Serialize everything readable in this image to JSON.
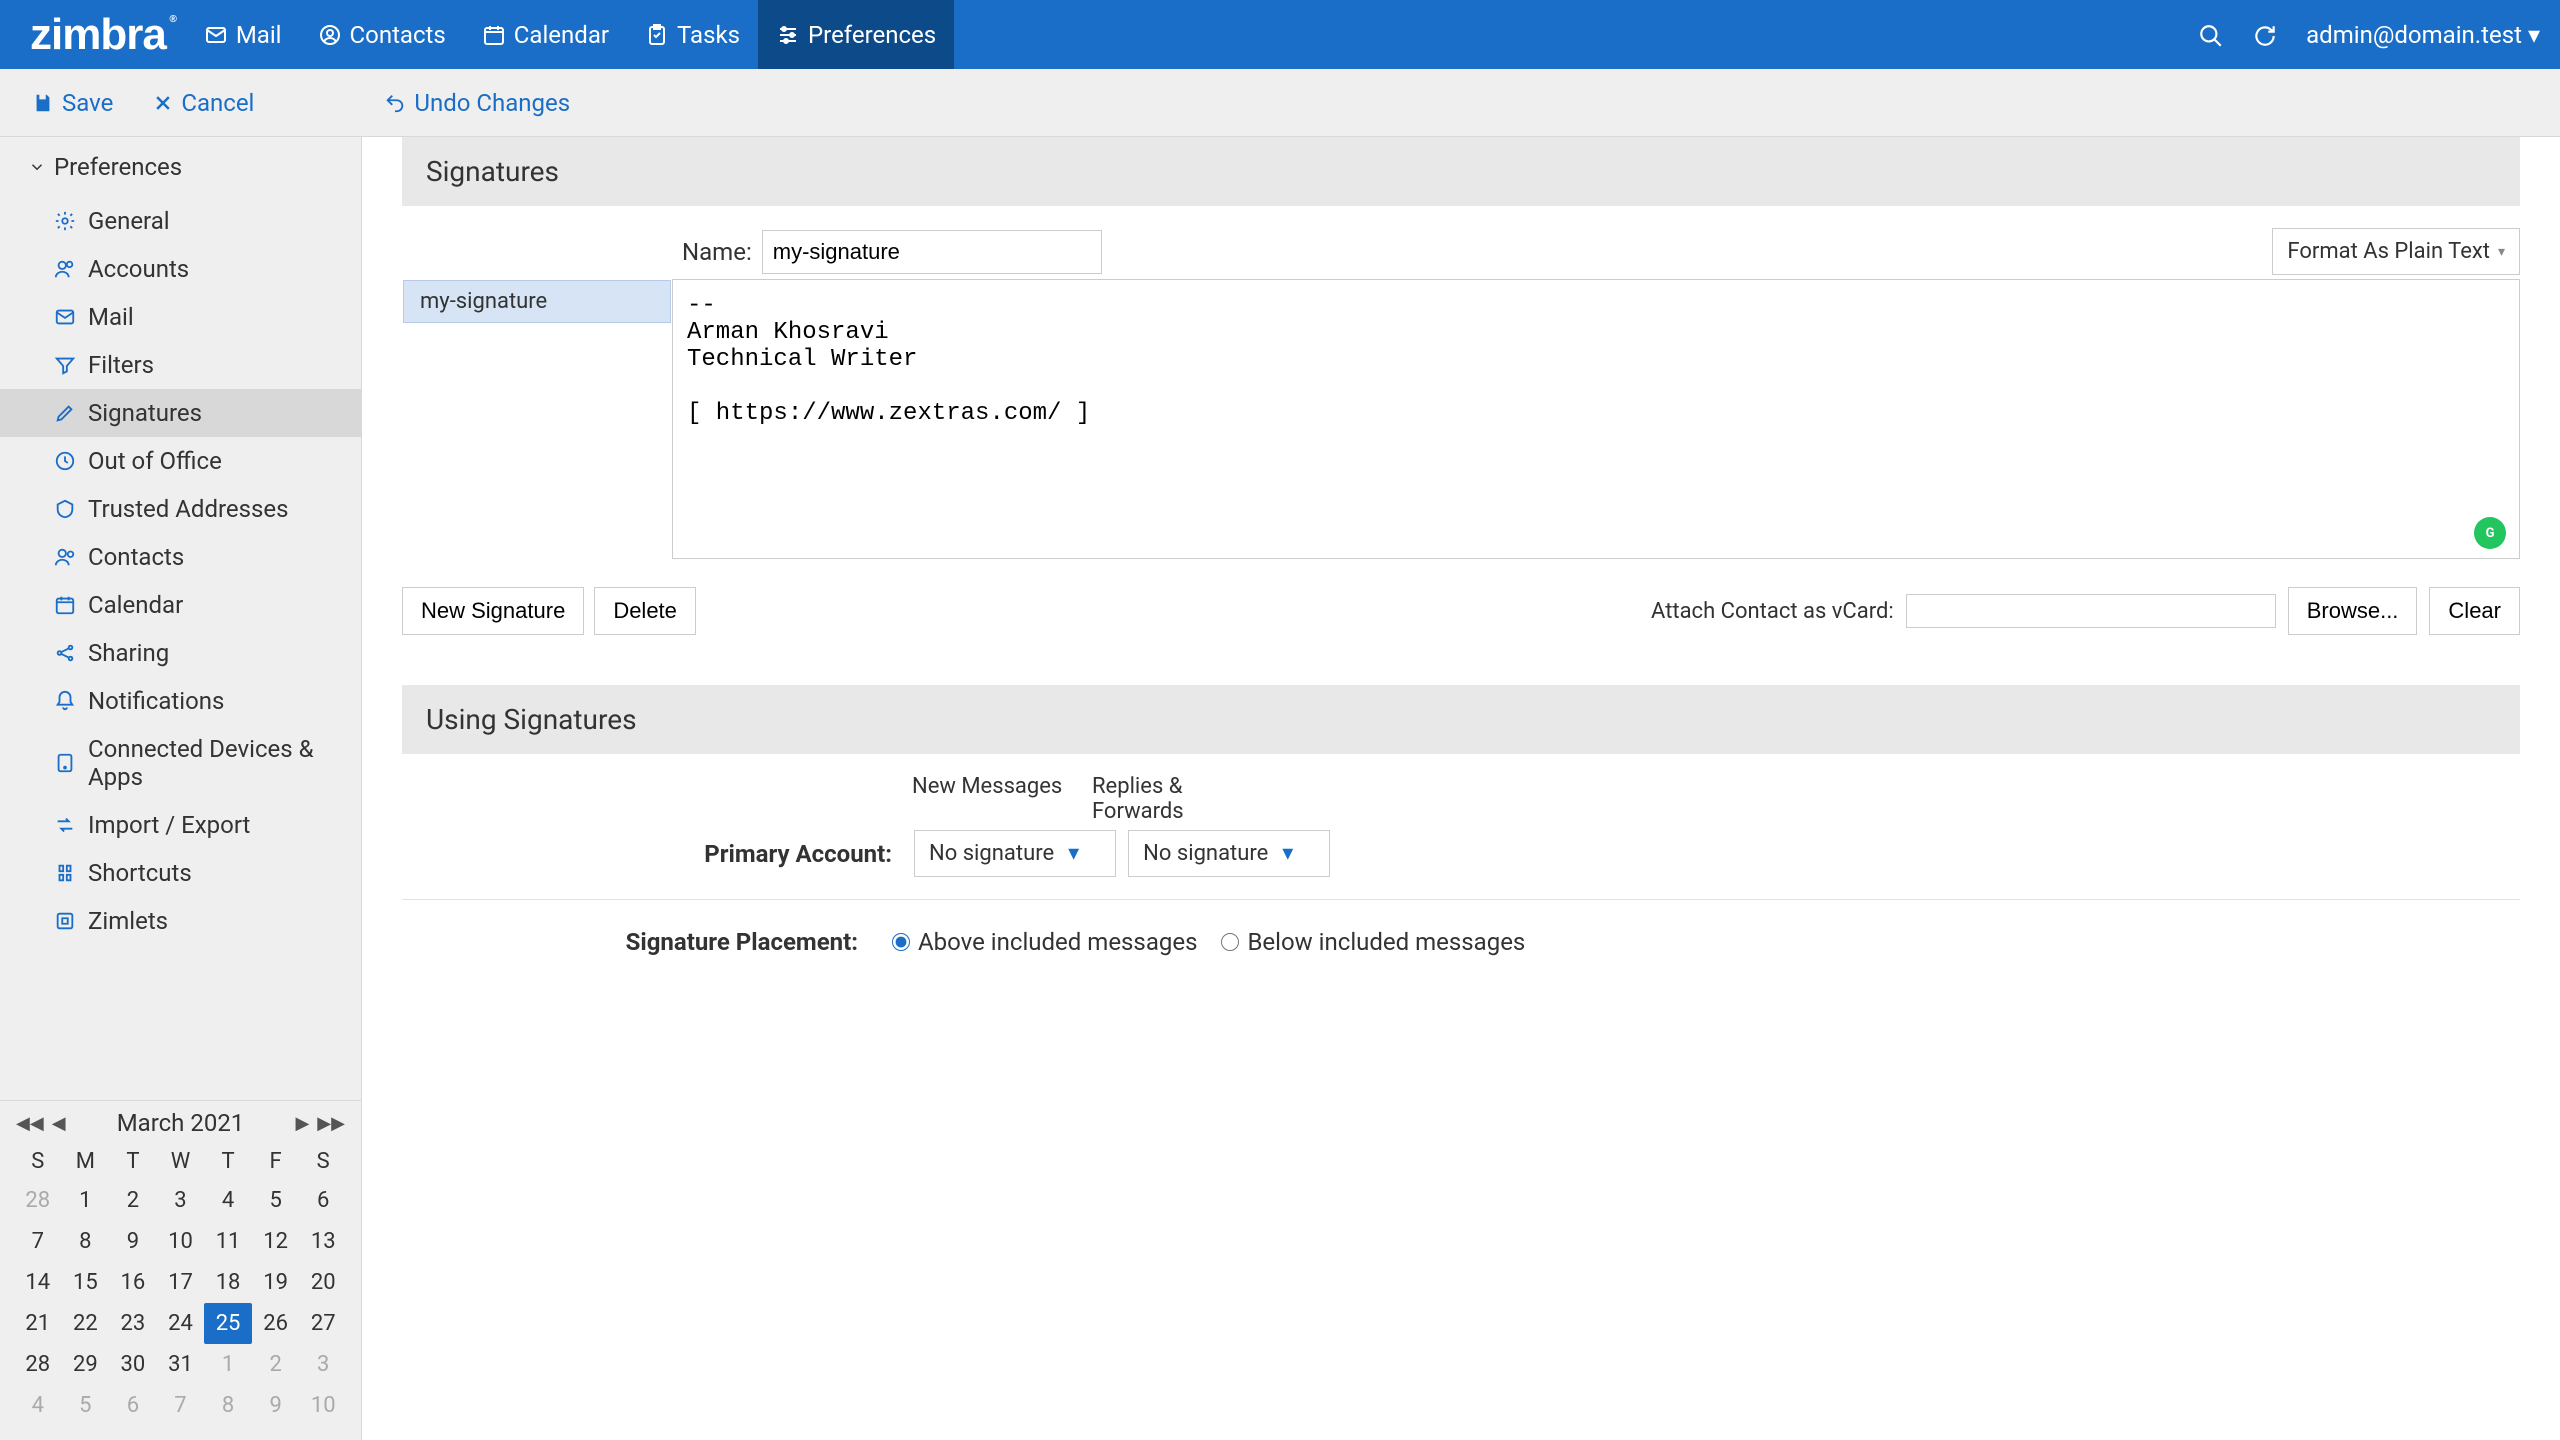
{
  "brand": "zimbra",
  "nav": {
    "tabs": [
      {
        "label": "Mail"
      },
      {
        "label": "Contacts"
      },
      {
        "label": "Calendar"
      },
      {
        "label": "Tasks"
      },
      {
        "label": "Preferences"
      }
    ],
    "user": "admin@domain.test"
  },
  "toolbar": {
    "save": "Save",
    "cancel": "Cancel",
    "undo": "Undo Changes"
  },
  "sidebar": {
    "header": "Preferences",
    "items": [
      {
        "label": "General"
      },
      {
        "label": "Accounts"
      },
      {
        "label": "Mail"
      },
      {
        "label": "Filters"
      },
      {
        "label": "Signatures"
      },
      {
        "label": "Out of Office"
      },
      {
        "label": "Trusted Addresses"
      },
      {
        "label": "Contacts"
      },
      {
        "label": "Calendar"
      },
      {
        "label": "Sharing"
      },
      {
        "label": "Notifications"
      },
      {
        "label": "Connected Devices & Apps"
      },
      {
        "label": "Import / Export"
      },
      {
        "label": "Shortcuts"
      },
      {
        "label": "Zimlets"
      }
    ]
  },
  "calendar": {
    "title": "March 2021",
    "dows": [
      "S",
      "M",
      "T",
      "W",
      "T",
      "F",
      "S"
    ],
    "weeks": [
      [
        {
          "d": "28",
          "dim": true
        },
        {
          "d": "1"
        },
        {
          "d": "2"
        },
        {
          "d": "3"
        },
        {
          "d": "4"
        },
        {
          "d": "5"
        },
        {
          "d": "6"
        }
      ],
      [
        {
          "d": "7"
        },
        {
          "d": "8"
        },
        {
          "d": "9"
        },
        {
          "d": "10"
        },
        {
          "d": "11"
        },
        {
          "d": "12"
        },
        {
          "d": "13"
        }
      ],
      [
        {
          "d": "14"
        },
        {
          "d": "15"
        },
        {
          "d": "16"
        },
        {
          "d": "17"
        },
        {
          "d": "18"
        },
        {
          "d": "19"
        },
        {
          "d": "20"
        }
      ],
      [
        {
          "d": "21"
        },
        {
          "d": "22"
        },
        {
          "d": "23"
        },
        {
          "d": "24"
        },
        {
          "d": "25",
          "today": true
        },
        {
          "d": "26"
        },
        {
          "d": "27"
        }
      ],
      [
        {
          "d": "28"
        },
        {
          "d": "29"
        },
        {
          "d": "30"
        },
        {
          "d": "31"
        },
        {
          "d": "1",
          "dim": true
        },
        {
          "d": "2",
          "dim": true
        },
        {
          "d": "3",
          "dim": true
        }
      ],
      [
        {
          "d": "4",
          "dim": true
        },
        {
          "d": "5",
          "dim": true
        },
        {
          "d": "6",
          "dim": true
        },
        {
          "d": "7",
          "dim": true
        },
        {
          "d": "8",
          "dim": true
        },
        {
          "d": "9",
          "dim": true
        },
        {
          "d": "10",
          "dim": true
        }
      ]
    ]
  },
  "signatures": {
    "section_title": "Signatures",
    "name_label": "Name:",
    "name_value": "my-signature",
    "format_label": "Format As Plain Text",
    "list": [
      {
        "label": "my-signature"
      }
    ],
    "body": "--\nArman Khosravi\nTechnical Writer\n\n[ https://www.zextras.com/ ]",
    "new_btn": "New Signature",
    "delete_btn": "Delete",
    "vcard_label": "Attach Contact as vCard:",
    "browse_btn": "Browse...",
    "clear_btn": "Clear"
  },
  "using": {
    "section_title": "Using Signatures",
    "col_new": "New Messages",
    "col_reply": "Replies & Forwards",
    "primary_label": "Primary Account:",
    "primary_new": "No signature",
    "primary_reply": "No signature",
    "placement_label": "Signature Placement:",
    "placement_above": "Above included messages",
    "placement_below": "Below included messages"
  }
}
